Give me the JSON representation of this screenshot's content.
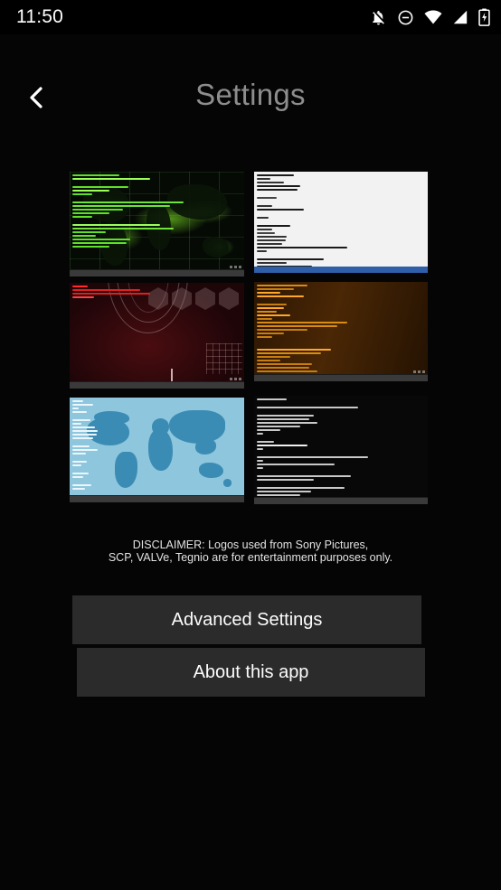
{
  "status_bar": {
    "time": "11:50",
    "icons": [
      {
        "name": "bell-off-icon",
        "label": "notifications silenced"
      },
      {
        "name": "do-not-disturb-icon",
        "label": "do not disturb"
      },
      {
        "name": "wifi-icon",
        "label": "wifi full"
      },
      {
        "name": "cellular-signal-icon",
        "label": "signal"
      },
      {
        "name": "battery-charging-icon",
        "label": "battery charging"
      }
    ]
  },
  "header": {
    "back_label": "‹",
    "title": "Settings"
  },
  "theme_grid": {
    "items": [
      {
        "id": "theme-green-matrix",
        "title": "Green matrix world map theme",
        "accent": "#7dff2a",
        "background": "#050a05"
      },
      {
        "id": "theme-white-code",
        "title": "White code theme",
        "accent": "#2f5fa8",
        "background": "#f2f2f2"
      },
      {
        "id": "theme-red-hud",
        "title": "Red HUD hexagon theme",
        "accent": "#ff2b2b",
        "background": "#1a0406"
      },
      {
        "id": "theme-amber-code",
        "title": "Amber code theme",
        "accent": "#ffa72b",
        "background": "#3a1f04"
      },
      {
        "id": "theme-blue-map",
        "title": "Blue world map theme",
        "accent": "#3b8cb4",
        "background": "#8ec6dd"
      },
      {
        "id": "theme-black-code",
        "title": "Black code theme",
        "accent": "#d8d8d8",
        "background": "#080808"
      }
    ]
  },
  "disclaimer": {
    "line1": "DISCLAIMER: Logos used from Sony Pictures,",
    "line2": "SCP, VALVe, Tegnio are for entertainment purposes only."
  },
  "buttons": {
    "advanced_settings": "Advanced Settings",
    "about_this_app": "About this app"
  },
  "colors": {
    "page_background": "#050505",
    "status_bar_background": "#000000",
    "title_text": "#8d8d8d",
    "button_background": "#2b2b2b",
    "button_text": "#fdfdfd",
    "disclaimer_text": "#e2e2e2"
  }
}
